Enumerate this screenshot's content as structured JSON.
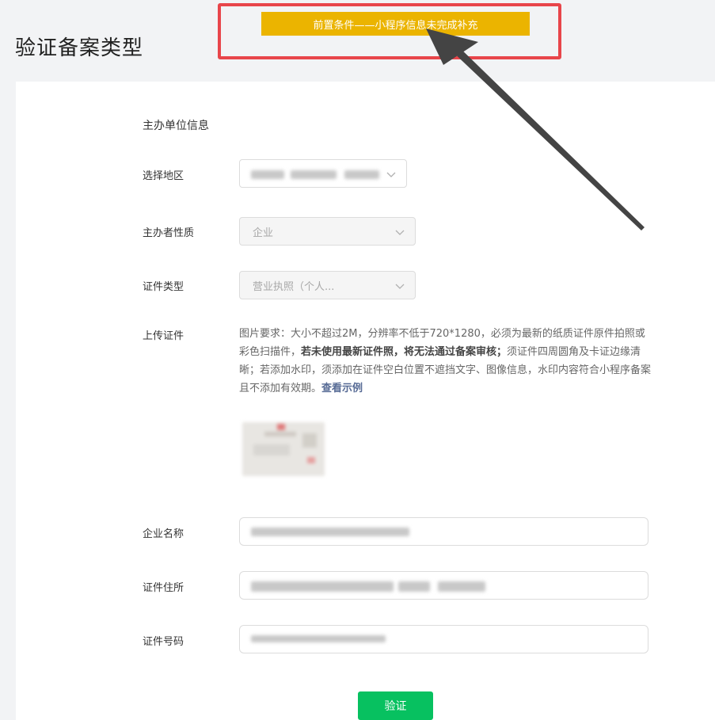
{
  "page_title": "验证备案类型",
  "notice": {
    "text": "前置条件——小程序信息未完成补充",
    "frame_color": "#e8454a",
    "banner_color": "#ebb400",
    "arrow_color": "#444444"
  },
  "section_title": "主办单位信息",
  "fields": {
    "region": {
      "label": "选择地区"
    },
    "organizer_nature": {
      "label": "主办者性质",
      "value": "企业"
    },
    "cert_type": {
      "label": "证件类型",
      "value": "营业执照（个人..."
    },
    "upload": {
      "label": "上传证件",
      "help_1": "图片要求：大小不超过2M，分辨率不低于720*1280，必须为最新的纸质证件原件拍照或彩色扫描件，",
      "help_bold_1": "若未使用最新证件照，将无法通过备案审核；",
      "help_2": "须证件四周圆角及卡证边缘清晰；若添加水印，须添加在证件空白位置不遮挡文字、图像信息，水印内容符合小程序备案且不添加有效期。",
      "help_link": "查看示例"
    },
    "company_name": {
      "label": "企业名称"
    },
    "cert_address": {
      "label": "证件住所"
    },
    "cert_number": {
      "label": "证件号码"
    }
  },
  "icons": {
    "chevron": "chevron-down-icon"
  },
  "verify_button": "验证",
  "accent_color": "#07c160"
}
